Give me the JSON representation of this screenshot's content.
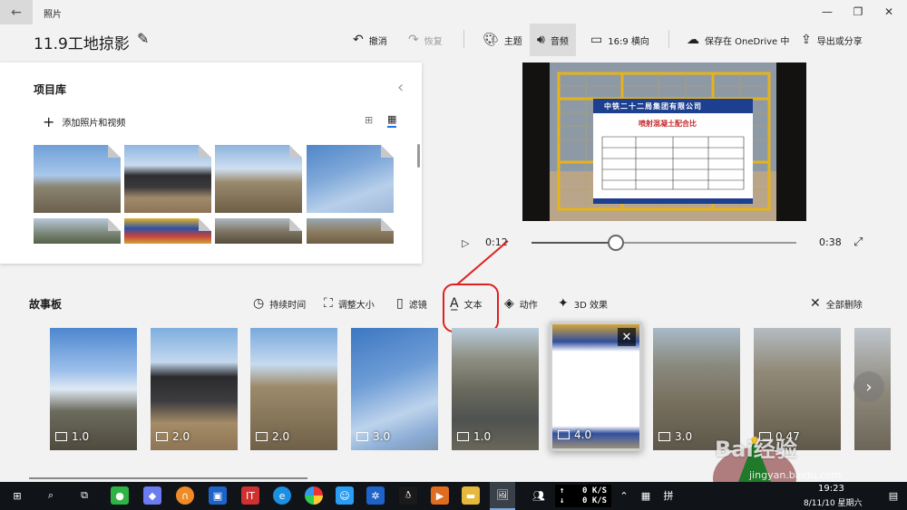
{
  "window": {
    "app_name": "照片",
    "back_icon": "back-arrow-icon",
    "controls": [
      "minimize-icon",
      "restore-icon",
      "close-icon"
    ]
  },
  "header": {
    "project_title": "11.9工地掠影",
    "undo": "撤消",
    "redo": "恢复",
    "theme": "主题",
    "audio": "音频",
    "aspect": "16:9 横向",
    "save_onedrive": "保存在 OneDrive 中",
    "export": "导出或分享"
  },
  "library": {
    "title": "项目库",
    "add_label": "添加照片和视频",
    "thumbnail_count": 8
  },
  "player": {
    "current_time": "0:12",
    "total_time": "0:38",
    "progress": 0.32,
    "sign_title": "中铁二十二局集团有限公司",
    "sign_subtitle": "喷射混凝土配合比"
  },
  "storyboard": {
    "title": "故事板",
    "tools": {
      "duration": "持续时间",
      "resize": "调整大小",
      "filters": "滤镜",
      "text": "文本",
      "motion": "动作",
      "effects3d": "3D 效果",
      "remove_all": "全部删除"
    },
    "clips": [
      {
        "duration": "1.0"
      },
      {
        "duration": "2.0"
      },
      {
        "duration": "2.0"
      },
      {
        "duration": "3.0"
      },
      {
        "duration": "1.0"
      },
      {
        "duration": "4.0"
      },
      {
        "duration": "3.0"
      },
      {
        "duration": "0.47"
      }
    ]
  },
  "taskbar": {
    "net_up": "0 K/S",
    "net_down": "0 K/S",
    "time": "19:23",
    "date": "8/11/10 星期六",
    "ime": "拼"
  },
  "watermark": {
    "text": "Bai经验",
    "url": "jingyan.baidu.com"
  },
  "colors": {
    "annotation_red": "#e02020",
    "selection_border": "#d0d0d0",
    "taskbar_bg": "#101418"
  }
}
